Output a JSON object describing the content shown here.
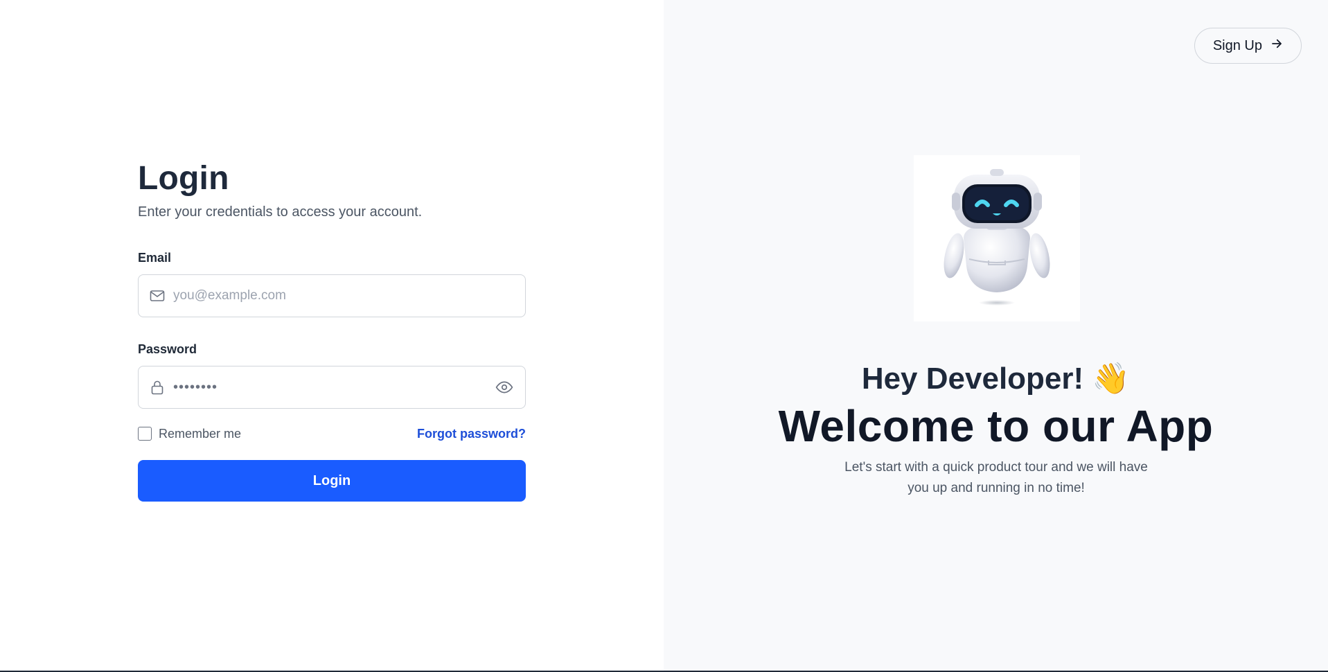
{
  "left_panel": {
    "title": "Login",
    "subtitle": "Enter your credentials to access your account.",
    "email": {
      "label": "Email",
      "placeholder": "you@example.com",
      "icon": "mail-icon"
    },
    "password": {
      "label": "Password",
      "masked_value": "••••••••",
      "icon": "lock-icon",
      "toggle_icon": "eye-icon"
    },
    "remember_me": {
      "label": "Remember me",
      "checked": false
    },
    "forgot_password": "Forgot password?",
    "login_button": "Login"
  },
  "right_panel": {
    "signup_button": "Sign Up",
    "signup_icon": "arrow-right-icon",
    "greeting": "Hey Developer! 👋",
    "headline": "Welcome to our App",
    "tagline": "Let's start with a quick product tour and we will have you up and running in no time!"
  },
  "colors": {
    "primary": "#1a5cff",
    "link": "#1d4ed8",
    "right_bg": "#f8f9fb",
    "heading": "#1e293b"
  }
}
